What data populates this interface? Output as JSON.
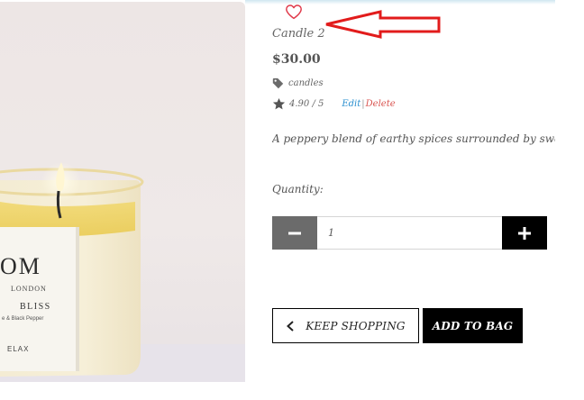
{
  "product": {
    "title": "Candle 2",
    "price": "$30.00",
    "category": "candles",
    "rating": "4.90 / 5",
    "description": "A peppery blend of earthy spices surrounded by sweet a"
  },
  "admin": {
    "edit_label": "Edit",
    "separator": "|",
    "delete_label": "Delete"
  },
  "quantity": {
    "label": "Quantity:",
    "value": "1"
  },
  "buttons": {
    "keep_shopping": "KEEP SHOPPING",
    "add_to_bag": "ADD TO BAG"
  },
  "image_label": {
    "brand_fragment": "OM",
    "city": "LONDON",
    "scent": "BLISS",
    "notes": "e & Black Pepper",
    "mood": "ELAX"
  },
  "icons": {
    "wishlist": "heart-outline-icon",
    "category": "tag-icon",
    "rating": "star-icon",
    "decrease": "minus-icon",
    "increase": "plus-icon",
    "back": "chevron-left-icon"
  },
  "colors": {
    "heart": "#e0394a",
    "annotation_arrow": "#e21b1b",
    "edit_link": "#2a8fcf",
    "delete_link": "#d9534f",
    "minus_bg": "#6b6b6b",
    "plus_bg": "#000000",
    "add_to_bag_bg": "#000000"
  }
}
